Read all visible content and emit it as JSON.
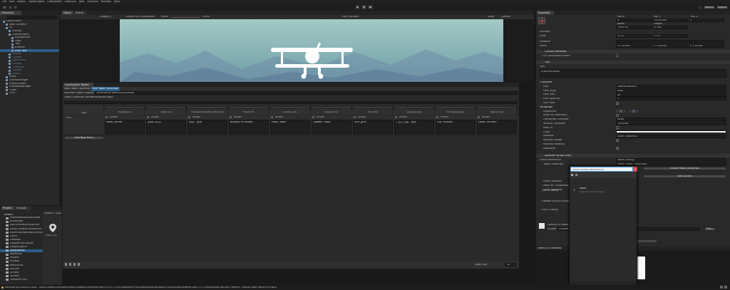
{
  "menu": {
    "items": [
      "File",
      "Edit",
      "Assets",
      "GameObject",
      "Component",
      "FastSync",
      "Jobs",
      "Services",
      "Window",
      "Help"
    ],
    "layers": "Layers",
    "layout": "Layout"
  },
  "hierarchy": {
    "tab": "Hierarchy",
    "items": [
      {
        "label": "LoadScene*",
        "depth": 0
      },
      {
        "label": "Main Camera",
        "depth": 1
      },
      {
        "label": "UI",
        "depth": 1
      },
      {
        "label": "Canvas",
        "depth": 2
      },
      {
        "label": "Canvas(dark)",
        "depth": 2
      },
      {
        "label": "Background",
        "depth": 3
      },
      {
        "label": "Logo",
        "depth": 3
      },
      {
        "label": "Text",
        "depth": 3
      },
      {
        "label": "Buttons",
        "depth": 3
      },
      {
        "label": "Auth Text",
        "depth": 3
      },
      {
        "label": "Canvas",
        "depth": 2
      },
      {
        "label": "Canvas",
        "depth": 2
      },
      {
        "label": "GameOver",
        "depth": 2
      },
      {
        "label": "Canvas",
        "depth": 2
      },
      {
        "label": "Continue",
        "depth": 2
      },
      {
        "label": "Canvas",
        "depth": 2
      },
      {
        "label": "Levels",
        "depth": 2
      },
      {
        "label": "Fader",
        "depth": 1
      },
      {
        "label": "SceneManager",
        "depth": 1
      },
      {
        "label": "EventSystem",
        "depth": 1
      },
      {
        "label": "FirebaseManager",
        "depth": 1
      },
      {
        "label": "Audio",
        "depth": 1
      },
      {
        "label": "GPM",
        "depth": 1
      }
    ]
  },
  "scene": {
    "tabs": [
      "Game",
      "Scene"
    ],
    "toolbar": {
      "display": "Display 1",
      "aspect": "1080x1920 Landscape",
      "scale_label": "Scale",
      "scale_value": "0.49x",
      "play_focused": "Play Focused",
      "stats": "Stats",
      "gizmos": "Gizmos"
    }
  },
  "localization": {
    "title": "Localization Tables",
    "toolbar_new": "New Table Collection",
    "toolbar_edit": "Edit Table Collection",
    "selected_label": "Selected Table Collection",
    "selected_value": "LocalizationTable(StringTable)",
    "collection_name_label": "Table Collection Name",
    "collection_name_value": "LocalizationTable",
    "key_header": "Key",
    "languages": [
      "English (en)",
      "Arabic (ar)",
      "Chinese (Simplified) (zh-Hans)",
      "French (fr)",
      "German (de)",
      "Russian (ru)",
      "Hindi (hi)",
      "Japanese (ja)",
      "Portuguese (pt)",
      "Spanish (es)"
    ],
    "smart_label": "Smart",
    "entry_key": "TEST",
    "values": [
      "Hello, world!",
      "مرحبا بالعالم",
      "你好，世界",
      "Bonjour le Monde",
      "Hallo, Welt!",
      "Привет, мир!",
      "नमस्ते दुनिया",
      "こんにちは、世界",
      "Olá, mundo!",
      "¡Hola, mundo!"
    ],
    "add_entry": "Add New Entry",
    "page_size_label": "Page Size",
    "page_size_value": "10"
  },
  "project": {
    "tabs": [
      "Project",
      "Console"
    ],
    "assets_header": "Assets",
    "breadcrumb": "Assets > Loc...",
    "folders": [
      "AddressableAssetsData",
      "Animation",
      "AsyncFieldSync/Sprites",
      "Editor Default Resources",
      "ExternalDependencyManager",
      "Fonts",
      "Firebase",
      "GooglePlayGames",
      "GoogleSignIn",
      "Localization",
      "Materials",
      "Plugins",
      "Prefabs",
      "Resources",
      "Scenes",
      "Scripts",
      "Sprites",
      "TextMesh Pro"
    ],
    "asset_name": "Arabic (ar)"
  },
  "inspector": {
    "tab": "Inspector",
    "rect": {
      "pos_x": "Pos X",
      "pos_y": "Pos Y",
      "pos_z": "Pos Z",
      "pos_x_val": "0",
      "pos_y_val": "-90.00000",
      "pos_z_val": "0",
      "width": "Width",
      "height": "Height",
      "width_val": "1469.94",
      "height_val": "87.68"
    },
    "anchors": "Anchors",
    "pivot": "Pivot",
    "pivot_x": "X 0.5",
    "pivot_y": "Y 0.5",
    "rotation": "Rotation",
    "scale": "Scale",
    "scale_x": "X 1.00000",
    "scale_y": "Y 1.00000",
    "scale_z": "Z 1.00000",
    "canvas_renderer": "Canvas Renderer",
    "cull_transparent": "Cull Transparent Mesh",
    "text_component": "Text",
    "text_label": "Text",
    "text_value": "Authentication",
    "character": "Character",
    "font": "Font",
    "font_val": "LiberationSans",
    "font_style": "Font Style",
    "font_style_val": "Bold",
    "font_size": "Font Size",
    "font_size_val": "60",
    "line_spacing": "Line Spacing",
    "line_spacing_val": "1",
    "rich_text": "Rich Text",
    "paragraph": "Paragraph",
    "alignment": "Alignment",
    "align_by_geometry": "Align By Geometry",
    "horizontal_overflow": "Horizontal Overflow",
    "horizontal_overflow_val": "Wrap",
    "vertical_overflow": "Vertical Overflow",
    "vertical_overflow_val": "Truncate",
    "best_fit": "Best Fit",
    "color": "Color",
    "material": "Material",
    "material_val": "None (Material)",
    "raycast_target": "Raycast Target",
    "raycast_padding": "Raycast Padding",
    "maskable": "Maskable",
    "localize_event": "Localize String Event",
    "string_reference": "String Reference",
    "string_reference_val": "None (String)",
    "table_collection": "Table Collection",
    "table_collection_val": "None (Table Collection)",
    "create_collection": "Create Table Collection",
    "add_locale": "Add Locale",
    "search_placeholder": "Select string table entry...",
    "list_none": "None",
    "list_none_desc": "Clear the current value",
    "event_fields": [
      "Event Fallback",
      "Wait For Completion",
      "Local Variables"
    ],
    "list_empty": "List is Empty",
    "update_string": "Update String (String)",
    "list_empty2": "List is Empty",
    "material_preview": "Default UI Material",
    "shader": "Shader",
    "shader_val": "UI/Default",
    "edit": "Edit...",
    "default_material": "Default UI Material"
  },
  "status": {
    "text": "Recording analytics data: ./lockin/sdk/bin/engine/editor/update/GameVersion=2022.2.23f1&platform=Windows&editorEdition=unity&packageVersion=1.3.16&Browser-Version Header: Enable Most Recent Plugins"
  },
  "colors": {
    "accent": "#2c5d87",
    "sky": "#8cb8ba",
    "sky_dark": "#5f8f95",
    "plane": "#ffffff",
    "selection": "#4d9be6"
  },
  "icons": [
    "play-icon",
    "pause-icon",
    "step-icon",
    "cloud-icon",
    "search-icon",
    "gear-icon",
    "lock-icon",
    "folder-icon",
    "cube-icon",
    "close-icon"
  ]
}
